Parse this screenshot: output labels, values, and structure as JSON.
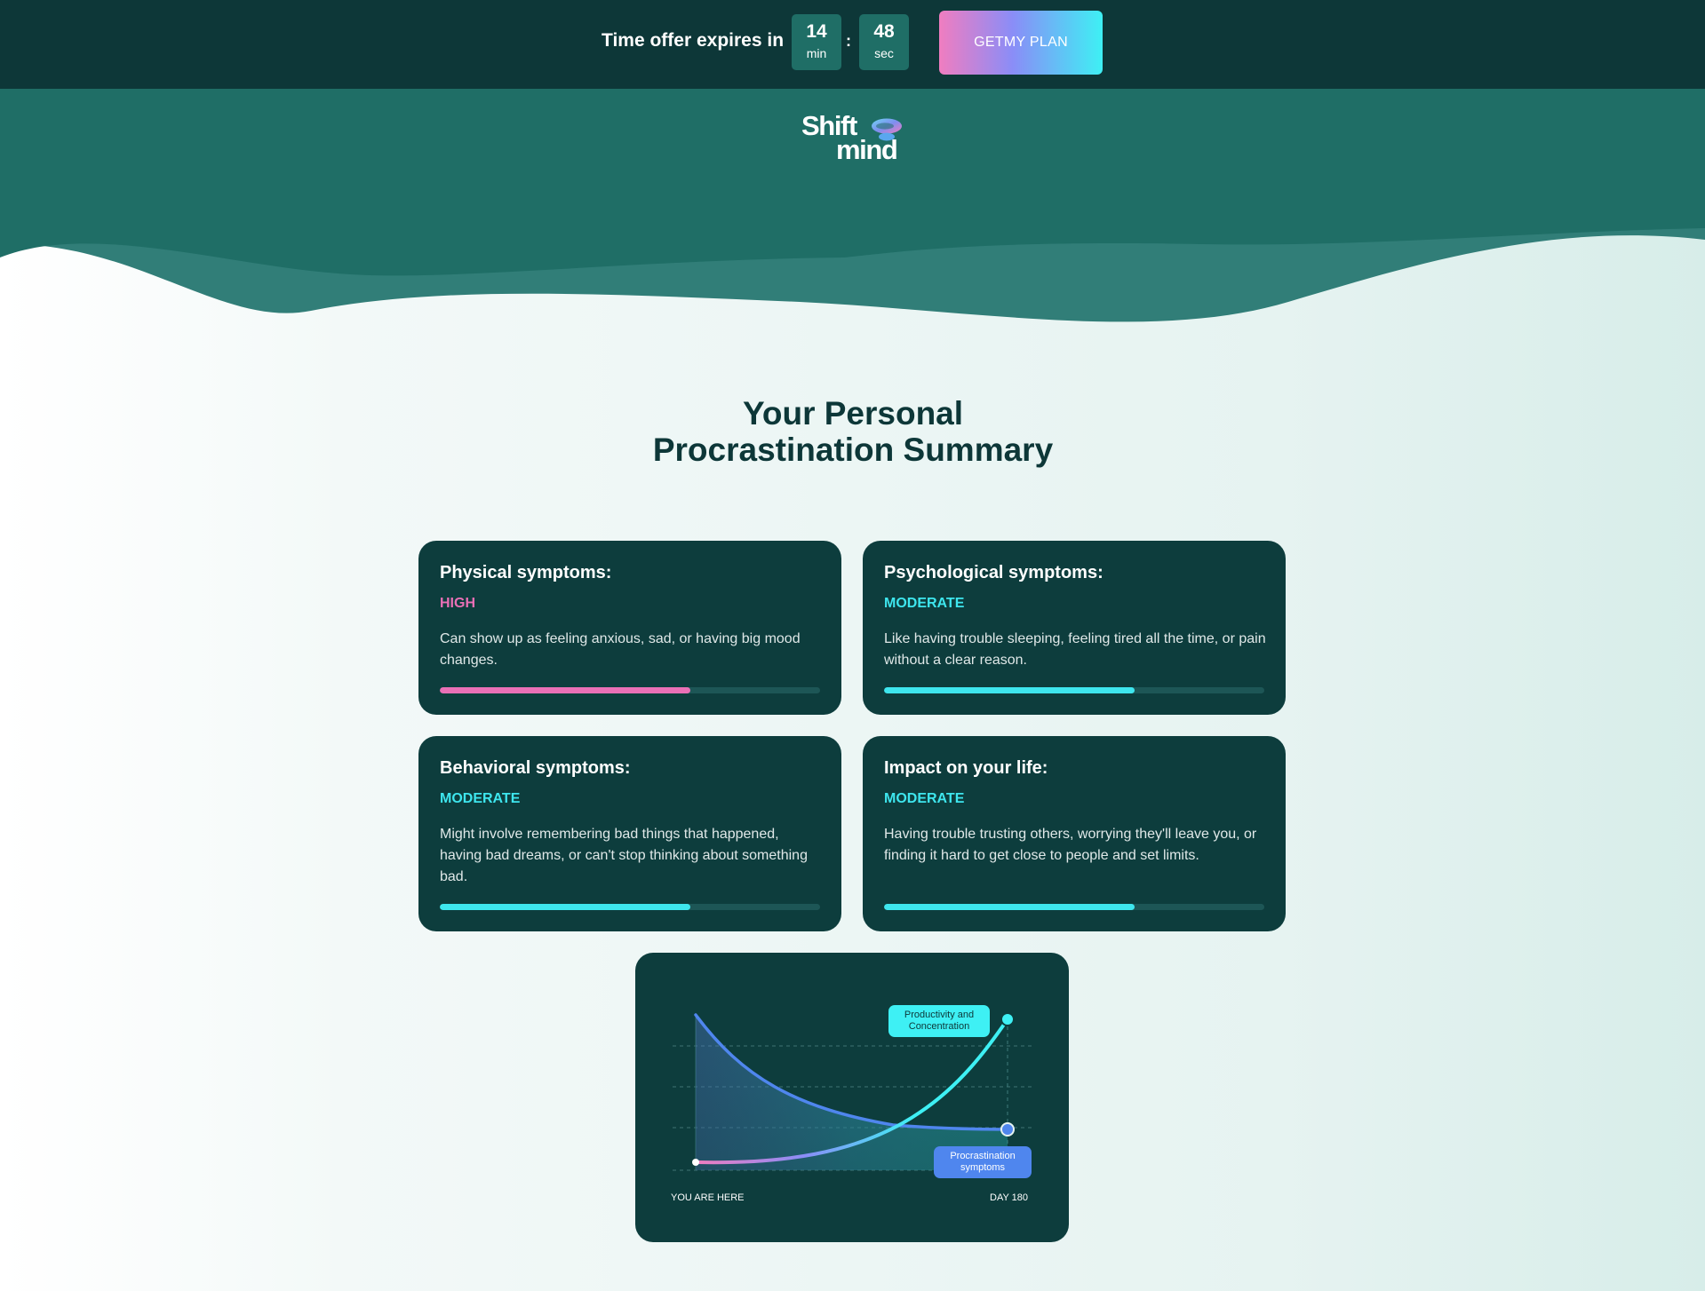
{
  "promo_bar": {
    "offer_text": "Time offer expires in",
    "minutes": "14",
    "minutes_unit": "min",
    "separator": ":",
    "seconds": "48",
    "seconds_unit": "sec",
    "cta_label": "GETMY PLAN"
  },
  "brand": {
    "line1": "Shift",
    "line2": "mind"
  },
  "title": {
    "line1": "Your Personal",
    "line2": "Procrastination Summary"
  },
  "cards": [
    {
      "title": "Physical symptoms:",
      "level": "HIGH",
      "description": "Can show up as feeling anxious, sad, or having big mood changes.",
      "progress": 0.66,
      "color": "#e970b6"
    },
    {
      "title": "Psychological symptoms:",
      "level": "MODERATE",
      "description": "Like having trouble sleeping, feeling tired all the time, or pain without a clear reason.",
      "progress": 0.66,
      "color": "#3ee6ee"
    },
    {
      "title": "Behavioral symptoms:",
      "level": "MODERATE",
      "description": "Might involve remembering bad things that happened, having bad dreams, or can't stop thinking about something bad.",
      "progress": 0.66,
      "color": "#3ee6ee"
    },
    {
      "title": "Impact on your life:",
      "level": "MODERATE",
      "description": "Having trouble trusting others, worrying they'll leave you, or finding it hard to get close to people and set limits.",
      "progress": 0.66,
      "color": "#3ee6ee"
    }
  ],
  "chart_data": {
    "type": "line",
    "x_labels": [
      "YOU ARE HERE",
      "DAY 180"
    ],
    "series": [
      {
        "name": "Productivity and Concentration",
        "trend": "rising",
        "color": "#3ef0f4"
      },
      {
        "name": "Procrastination symptoms",
        "trend": "falling",
        "color": "#4f86ee"
      }
    ],
    "grid": true
  },
  "colors": {
    "dark_teal": "#0d3738",
    "card_bg": "#0d3d3d",
    "hero_teal": "#1f6e66",
    "wave_teal": "#317e78",
    "accent_pink": "#e970b6",
    "accent_cyan": "#3ee6ee",
    "accent_blue": "#4f86ee"
  },
  "icons": {
    "logo_mark": "brain-swirl-icon"
  }
}
